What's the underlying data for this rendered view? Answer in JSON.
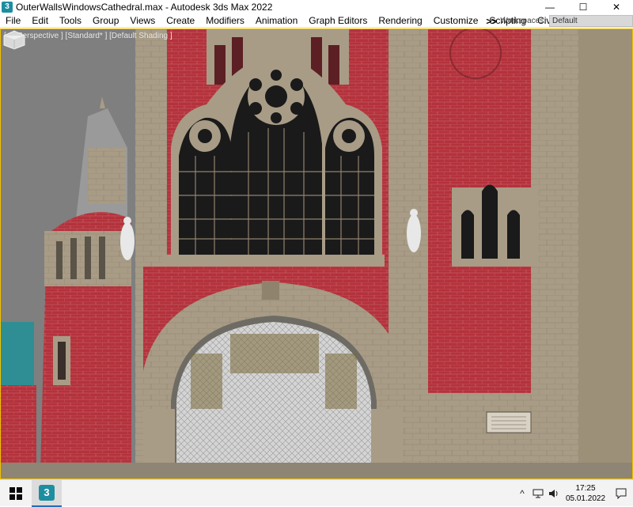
{
  "window": {
    "title": "OuterWallsWindowsCathedral.max - Autodesk 3ds Max 2022",
    "app_icon_glyph": "3",
    "controls": {
      "minimize": "—",
      "maximize": "☐",
      "close": "✕"
    }
  },
  "menubar": {
    "items": [
      "File",
      "Edit",
      "Tools",
      "Group",
      "Views",
      "Create",
      "Modifiers",
      "Animation",
      "Graph Editors",
      "Rendering",
      "Customize",
      "Scripting",
      "Civil View"
    ],
    "overflow_glyph": ">>",
    "workspaces_label": "Workspaces:",
    "workspaces_value": "Default"
  },
  "viewport": {
    "label": "[+] [Perspective ] [Standard* ] [Default Shading ]",
    "plaque_text": "",
    "colors": {
      "brick": "#b4323c",
      "stone": "#a89c86",
      "sky": "#7f7f7f",
      "window_dark": "#1a1a1a",
      "copper_roof": "#2f8e93"
    }
  },
  "taskbar": {
    "start_icon": "windows-logo",
    "app_glyph": "3",
    "tray": {
      "chevron": "^",
      "time": "17:25",
      "date": "05.01.2022"
    }
  }
}
